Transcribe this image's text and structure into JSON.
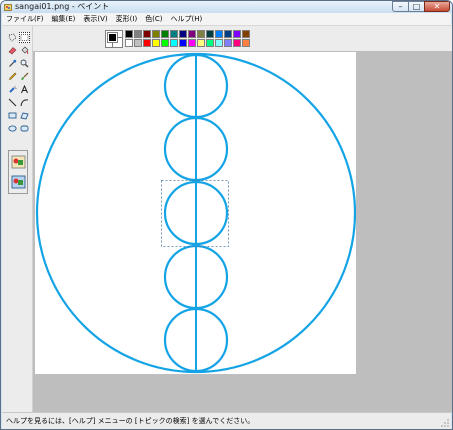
{
  "window": {
    "title": "sangai01.png - ペイント",
    "controls": {
      "minimize": "–",
      "maximize": "□",
      "close": "✕"
    }
  },
  "menu": [
    "ファイル(F)",
    "編集(E)",
    "表示(V)",
    "変形(I)",
    "色(C)",
    "ヘルプ(H)"
  ],
  "tools": [
    {
      "name": "free-select-tool",
      "icon": "free-select-icon"
    },
    {
      "name": "rect-select-tool",
      "icon": "rect-select-icon",
      "selected": true
    },
    {
      "name": "eraser-tool",
      "icon": "eraser-icon"
    },
    {
      "name": "fill-tool",
      "icon": "fill-bucket-icon"
    },
    {
      "name": "color-picker-tool",
      "icon": "eyedropper-icon"
    },
    {
      "name": "magnifier-tool",
      "icon": "magnifier-icon"
    },
    {
      "name": "pencil-tool",
      "icon": "pencil-icon"
    },
    {
      "name": "brush-tool",
      "icon": "brush-icon"
    },
    {
      "name": "airbrush-tool",
      "icon": "airbrush-icon"
    },
    {
      "name": "text-tool",
      "icon": "text-icon"
    },
    {
      "name": "line-tool",
      "icon": "line-icon"
    },
    {
      "name": "curve-tool",
      "icon": "curve-icon"
    },
    {
      "name": "rectangle-tool",
      "icon": "rectangle-icon"
    },
    {
      "name": "polygon-tool",
      "icon": "polygon-icon"
    },
    {
      "name": "ellipse-tool",
      "icon": "ellipse-icon"
    },
    {
      "name": "rounded-rect-tool",
      "icon": "rounded-rect-icon"
    }
  ],
  "colors": {
    "foreground": "#000000",
    "background": "#ffffff",
    "palette": [
      "#000000",
      "#808080",
      "#800000",
      "#808000",
      "#008000",
      "#008080",
      "#000080",
      "#800080",
      "#808040",
      "#004040",
      "#0080ff",
      "#004080",
      "#8000ff",
      "#804000",
      "#ffffff",
      "#c0c0c0",
      "#ff0000",
      "#ffff00",
      "#00ff00",
      "#00ffff",
      "#0000ff",
      "#ff00ff",
      "#ffff80",
      "#00ff80",
      "#80ffff",
      "#8080ff",
      "#ff0080",
      "#ff8040"
    ],
    "drawing": "#14a4e6",
    "selection": "#4a7ca8"
  },
  "statusbar": {
    "text": "ヘルプを見るには、[ヘルプ] メニューの [トピックの検索] を選んでください。"
  }
}
